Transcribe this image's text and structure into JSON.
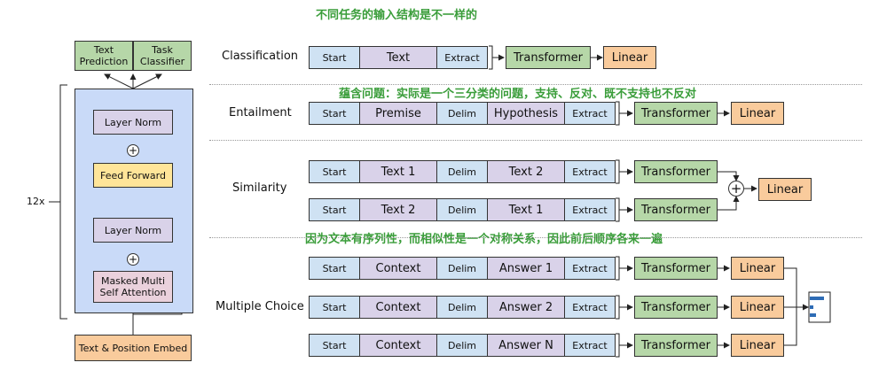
{
  "notes": {
    "top": "不同任务的输入结构是不一样的",
    "entailment": "蕴含问题：实际是一个三分类的问题，支持、反对、既不支持也不反对",
    "similarity": "因为文本有序列性，而相似性是一个对称关系，因此前后顺序各来一遍"
  },
  "model": {
    "text_prediction": "Text\nPrediction",
    "task_classifier": "Task\nClassifier",
    "layer_norm_top": "Layer Norm",
    "feed_forward": "Feed Forward",
    "layer_norm_bottom": "Layer Norm",
    "masked_attention": "Masked Multi\nSelf Attention",
    "embed": "Text & Position Embed",
    "repeat": "12x",
    "plus": "+"
  },
  "tasks": {
    "classification": "Classification",
    "entailment": "Entailment",
    "similarity": "Similarity",
    "multiple_choice": "Multiple Choice"
  },
  "tokens": {
    "start": "Start",
    "extract": "Extract",
    "delim": "Delim",
    "text": "Text",
    "premise": "Premise",
    "hypothesis": "Hypothesis",
    "text1": "Text 1",
    "text2": "Text 2",
    "context": "Context",
    "answer1": "Answer 1",
    "answer2": "Answer 2",
    "answerN": "Answer N"
  },
  "blocks": {
    "transformer": "Transformer",
    "linear": "Linear",
    "plus": "+"
  },
  "colors": {
    "start_extract": "#cfe2f3",
    "text_tokens": "#d9d2e9",
    "transformer": "#b6d7a8",
    "linear": "#f9cb9c",
    "feed_forward": "#ffe599",
    "attention": "#ead1dc",
    "panel": "#c9daf8",
    "note": "#3a9d3a"
  }
}
